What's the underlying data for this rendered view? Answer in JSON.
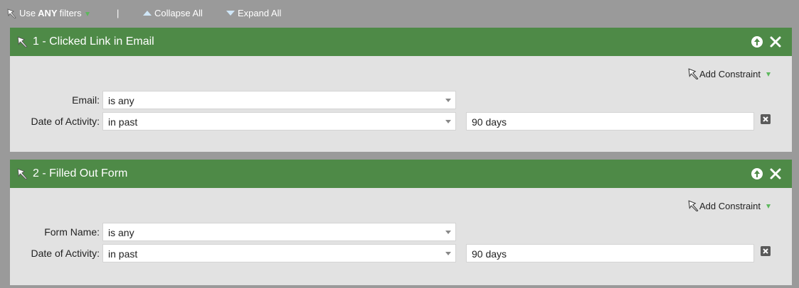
{
  "toolbar": {
    "use_prefix": "Use",
    "use_strong": "ANY",
    "use_suffix": "filters",
    "separator": "|",
    "collapse_label": "Collapse All",
    "expand_label": "Expand All"
  },
  "filters": [
    {
      "title": "1 - Clicked Link in Email",
      "add_constraint": "Add Constraint",
      "rows": [
        {
          "label": "Email:",
          "operator": "is any"
        },
        {
          "label": "Date of Activity:",
          "operator": "in past",
          "value": "90 days"
        }
      ]
    },
    {
      "title": "2 - Filled Out Form",
      "add_constraint": "Add Constraint",
      "rows": [
        {
          "label": "Form Name:",
          "operator": "is any"
        },
        {
          "label": "Date of Activity:",
          "operator": "in past",
          "value": "90 days"
        }
      ]
    }
  ],
  "colors": {
    "header_green": "#4e8a47",
    "toolbar_gray": "#9a9a9a",
    "panel_gray": "#e2e2e2"
  }
}
